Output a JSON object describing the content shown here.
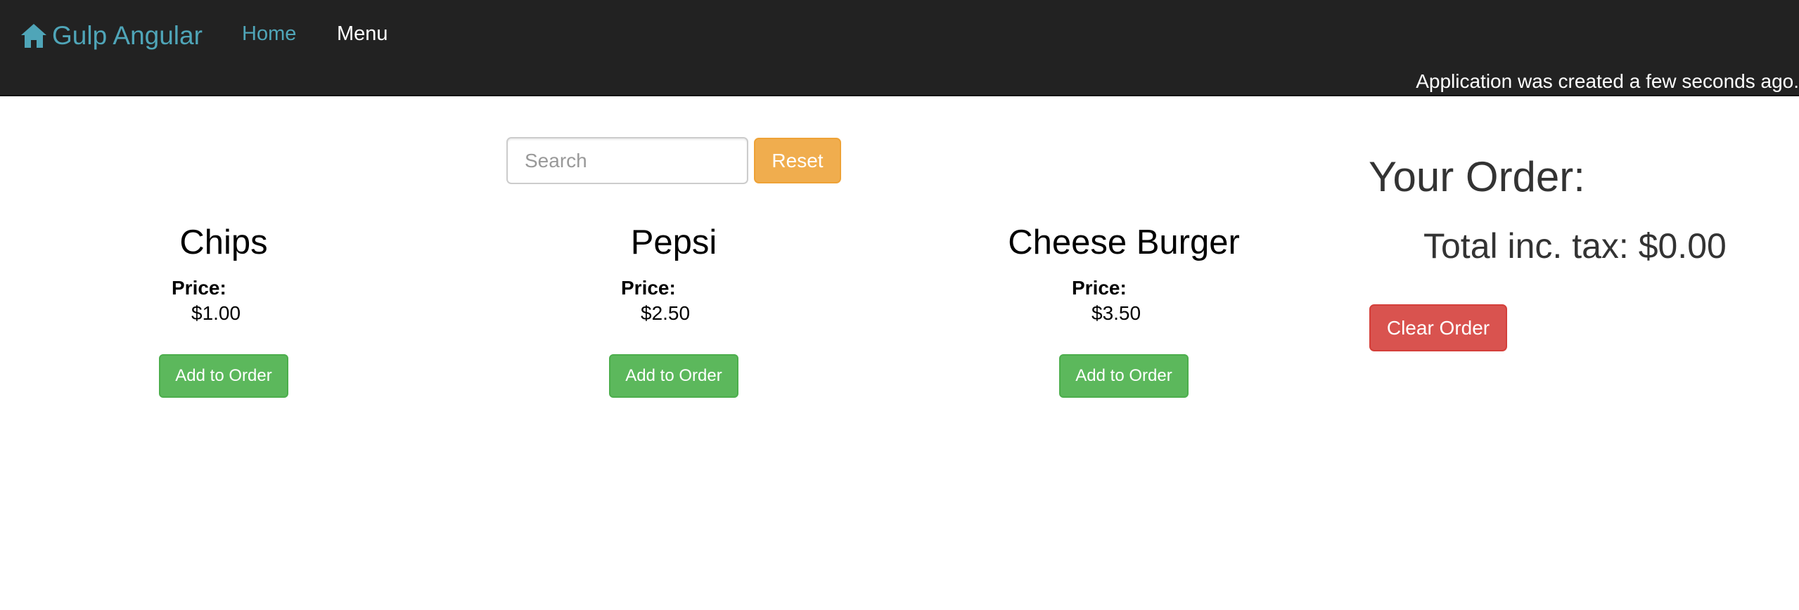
{
  "navbar": {
    "brand_label": "Gulp Angular",
    "brand_icon": "home-icon",
    "links": [
      {
        "label": "Home"
      },
      {
        "label": "Menu"
      }
    ],
    "created_note": "Application was created a few seconds ago."
  },
  "search": {
    "placeholder": "Search",
    "value": "",
    "reset_label": "Reset"
  },
  "menu_items": [
    {
      "name": "Chips",
      "price_label": "Price:",
      "price": "$1.00",
      "add_label": "Add to Order"
    },
    {
      "name": "Pepsi",
      "price_label": "Price:",
      "price": "$2.50",
      "add_label": "Add to Order"
    },
    {
      "name": "Cheese Burger",
      "price_label": "Price:",
      "price": "$3.50",
      "add_label": "Add to Order"
    }
  ],
  "order": {
    "heading": "Your Order:",
    "total": "Total inc. tax: $0.00",
    "clear_label": "Clear Order"
  },
  "colors": {
    "navbar_bg": "#222222",
    "brand_accent": "#4fa5b8",
    "warning": "#f0ad4e",
    "success": "#5cb85c",
    "danger": "#d9534f"
  }
}
